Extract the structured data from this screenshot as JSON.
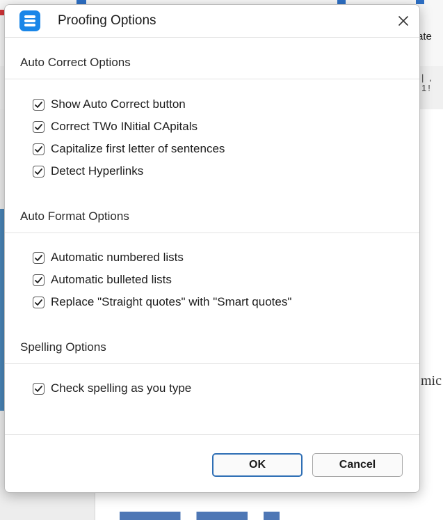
{
  "background": {
    "toolbar_label": "ate",
    "ruler_marks": "| , 1!",
    "doc_text_fragment": "mic"
  },
  "dialog": {
    "title": "Proofing Options",
    "close_icon": "close-icon",
    "app_icon": "menu-list-icon",
    "accent_color": "#1a86e8",
    "sections": [
      {
        "title": "Auto Correct Options",
        "options": [
          {
            "label": "Show Auto Correct button",
            "checked": true
          },
          {
            "label": "Correct TWo INitial CApitals",
            "checked": true
          },
          {
            "label": "Capitalize first letter of sentences",
            "checked": true
          },
          {
            "label": "Detect Hyperlinks",
            "checked": true
          }
        ]
      },
      {
        "title": "Auto Format Options",
        "options": [
          {
            "label": "Automatic numbered lists",
            "checked": true
          },
          {
            "label": "Automatic bulleted lists",
            "checked": true
          },
          {
            "label": "Replace \"Straight quotes\" with \"Smart quotes\"",
            "checked": true
          }
        ]
      },
      {
        "title": "Spelling Options",
        "options": [
          {
            "label": "Check spelling as you type",
            "checked": true
          }
        ]
      }
    ],
    "buttons": {
      "ok_label": "OK",
      "cancel_label": "Cancel"
    }
  }
}
